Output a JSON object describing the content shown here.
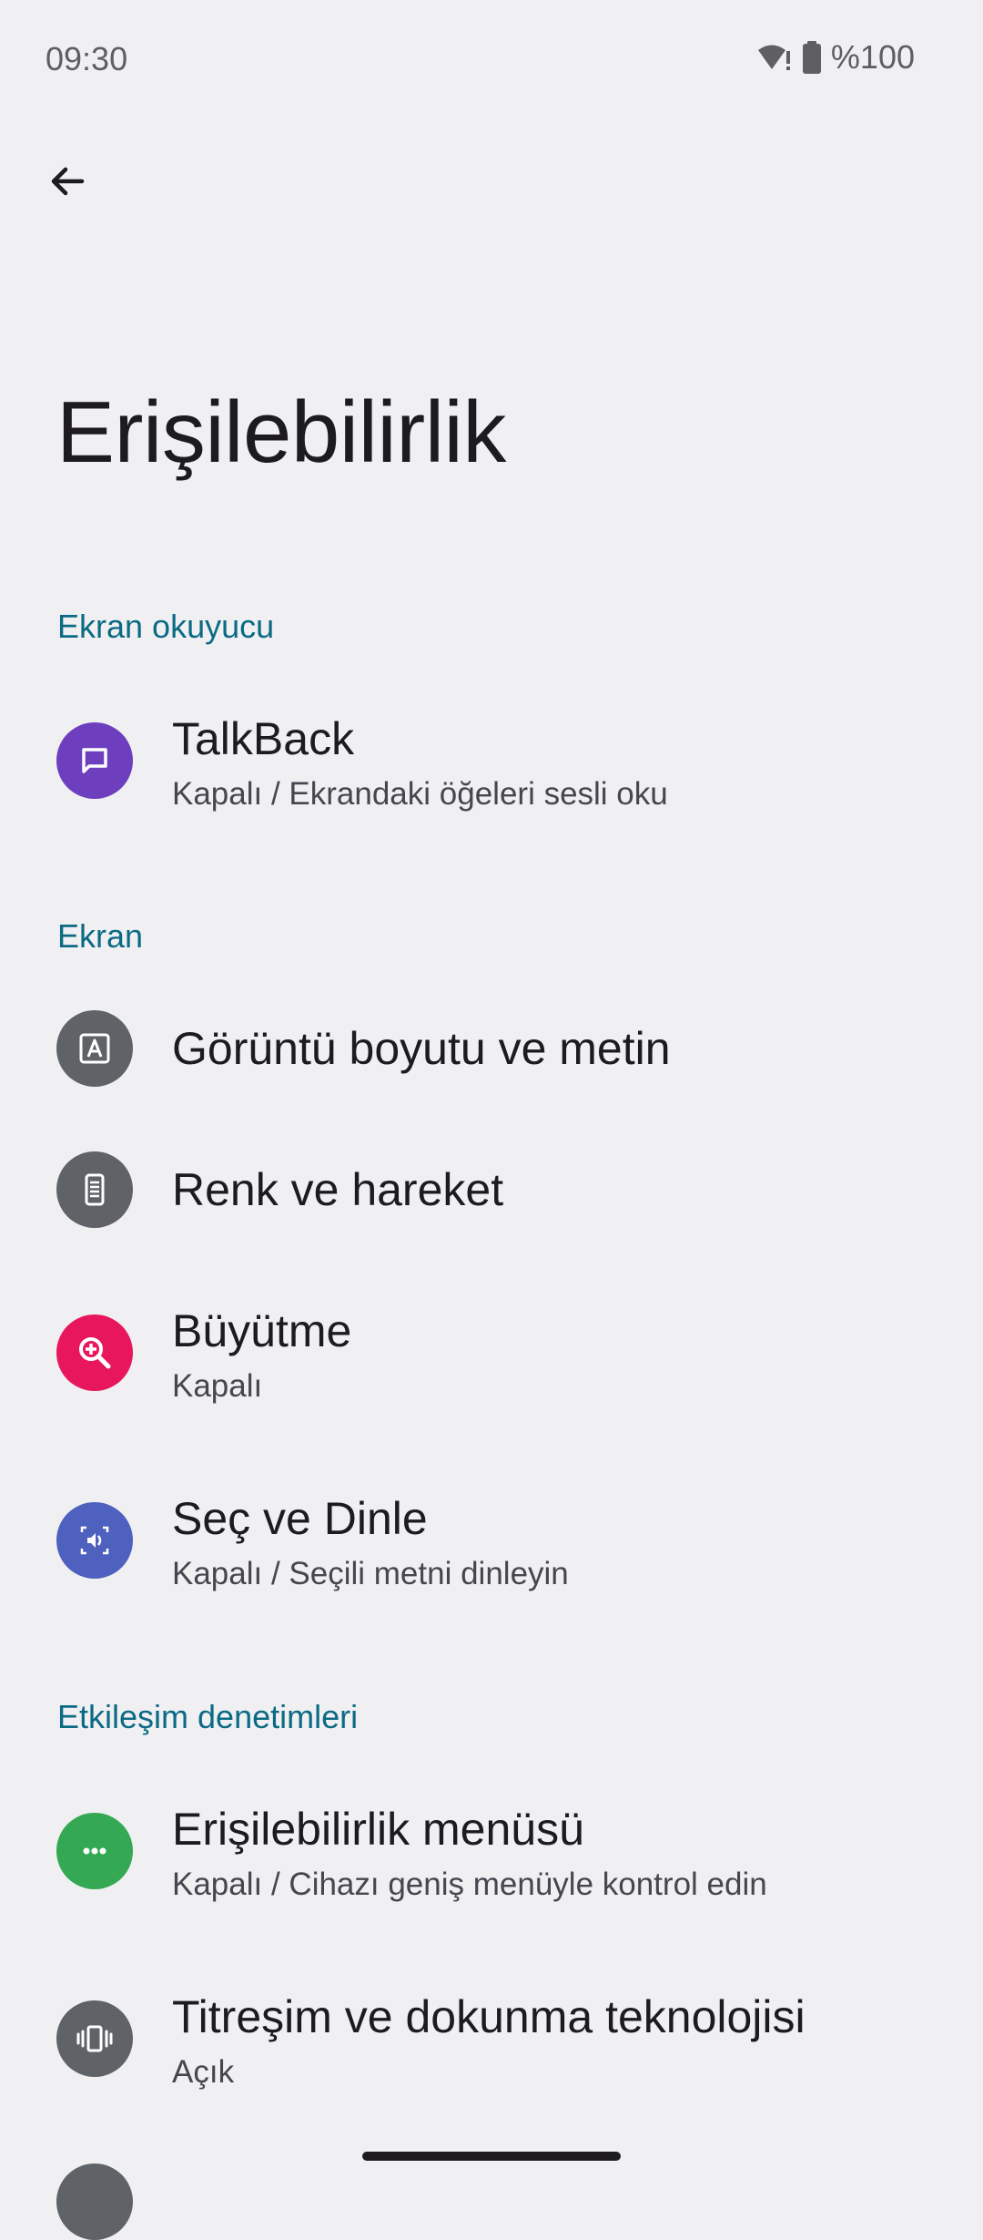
{
  "status_bar": {
    "time": "09:30",
    "battery": "%100",
    "icons": [
      "wifi-alert-icon",
      "battery-icon"
    ]
  },
  "toolbar": {
    "back_icon": "arrow-back-icon"
  },
  "page": {
    "title": "Erişilebilirlik"
  },
  "sections": [
    {
      "header": "Ekran okuyucu",
      "items": [
        {
          "title": "TalkBack",
          "summary": "Kapalı / Ekrandaki öğeleri sesli oku",
          "icon": "talkback-icon",
          "color": "#6d3fbf"
        }
      ]
    },
    {
      "header": "Ekran",
      "items": [
        {
          "title": "Görüntü boyutu ve metin",
          "summary": "",
          "icon": "text-size-icon",
          "color": "#5f6368"
        },
        {
          "title": "Renk ve hareket",
          "summary": "",
          "icon": "phone-color-icon",
          "color": "#5f6368"
        },
        {
          "title": "Büyütme",
          "summary": "Kapalı",
          "icon": "zoom-in-icon",
          "color": "#e8175d"
        },
        {
          "title": "Seç ve Dinle",
          "summary": "Kapalı / Seçili metni dinleyin",
          "icon": "select-to-speak-icon",
          "color": "#4f61bf"
        }
      ]
    },
    {
      "header": "Etkileşim denetimleri",
      "items": [
        {
          "title": "Erişilebilirlik menüsü",
          "summary": "Kapalı / Cihazı geniş menüyle kontrol edin",
          "icon": "more-horiz-icon",
          "color": "#34a853"
        },
        {
          "title": "Titreşim ve dokunma teknolojisi",
          "summary": "Açık",
          "icon": "vibration-icon",
          "color": "#5f6368"
        }
      ]
    }
  ]
}
